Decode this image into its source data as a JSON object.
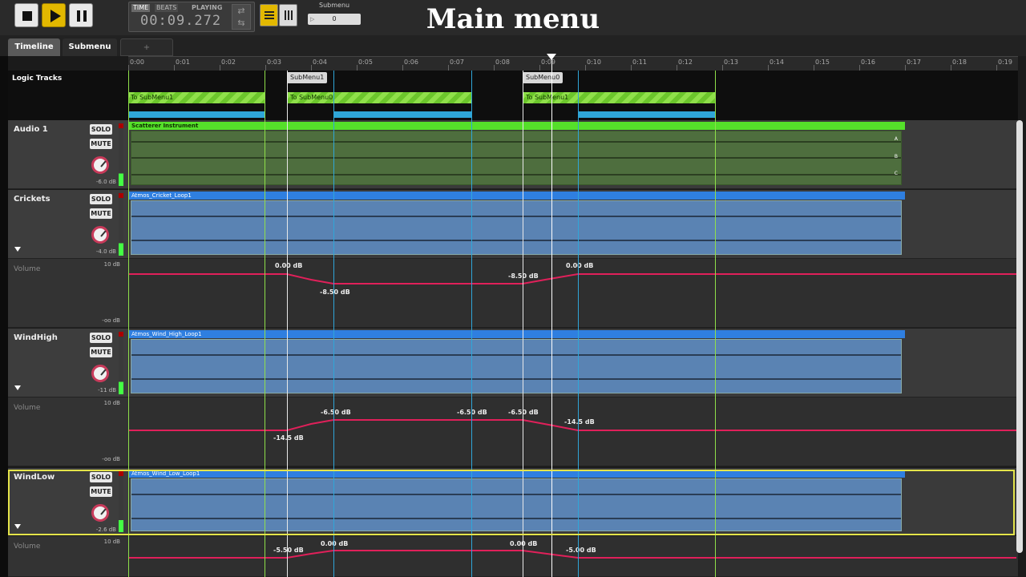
{
  "transport": {
    "stop": "stop-icon",
    "play": "play-icon",
    "pause": "pause-icon",
    "time_tab": "TIME",
    "beats_tab": "BEATS",
    "status": "PLAYING",
    "clock": "00:09.272",
    "sync_icon": "sync-icon",
    "view_list": "list-view-icon",
    "view_grid": "grid-view-icon",
    "param_label": "Submenu",
    "param_value": "0"
  },
  "caption": "Main menu",
  "tabs": [
    {
      "label": "Timeline"
    },
    {
      "label": "Submenu"
    },
    {
      "label": "+"
    }
  ],
  "ruler": [
    "0:00",
    "0:01",
    "0:02",
    "0:03",
    "0:04",
    "0:05",
    "0:06",
    "0:07",
    "0:08",
    "0:09",
    "0:10",
    "0:11",
    "0:12",
    "0:13",
    "0:14",
    "0:15",
    "0:16",
    "0:17",
    "0:18",
    "0:19"
  ],
  "logic": {
    "label": "Logic Tracks",
    "markers": [
      "SubMenu1",
      "SubMenu0"
    ],
    "regions": [
      "To SubMenu1",
      "To SubMenu0",
      "To SubMenu1"
    ]
  },
  "tracks": [
    {
      "name": "Audio 1",
      "solo": "SOLO",
      "mute": "MUTE",
      "db": "-6.0 dB",
      "clip": "Scatterer Instrument",
      "lanes": [
        "A",
        "B",
        "C"
      ]
    },
    {
      "name": "Crickets",
      "solo": "SOLO",
      "mute": "MUTE",
      "db": "-4.0 dB",
      "clip": "Atmos_Cricket_Loop1"
    },
    {
      "name": "WindHigh",
      "solo": "SOLO",
      "mute": "MUTE",
      "db": "-11 dB",
      "clip": "Atmos_Wind_High_Loop1"
    },
    {
      "name": "WindLow",
      "solo": "SOLO",
      "mute": "MUTE",
      "db": "-2.6 dB",
      "clip": "Atmos_Wind_Low_Loop1"
    }
  ],
  "volume": {
    "label": "Volume",
    "max": "10 dB",
    "min": "-oo dB",
    "crickets": [
      "0.00 dB",
      "-8.50 dB",
      "-8.50 dB",
      "0.00 dB"
    ],
    "windhigh": [
      "-14.5 dB",
      "-6.50 dB",
      "-6.50 dB",
      "-6.50 dB",
      "-14.5 dB"
    ],
    "windlow": [
      "-5.50 dB",
      "0.00 dB",
      "0.00 dB",
      "-5.00 dB"
    ]
  },
  "colors": {
    "accent": "#e2b800",
    "envelope": "#e0205a",
    "clip_blue": "#2f7fe0",
    "clip_green": "#55e02a",
    "selection": "#e4e44a"
  }
}
